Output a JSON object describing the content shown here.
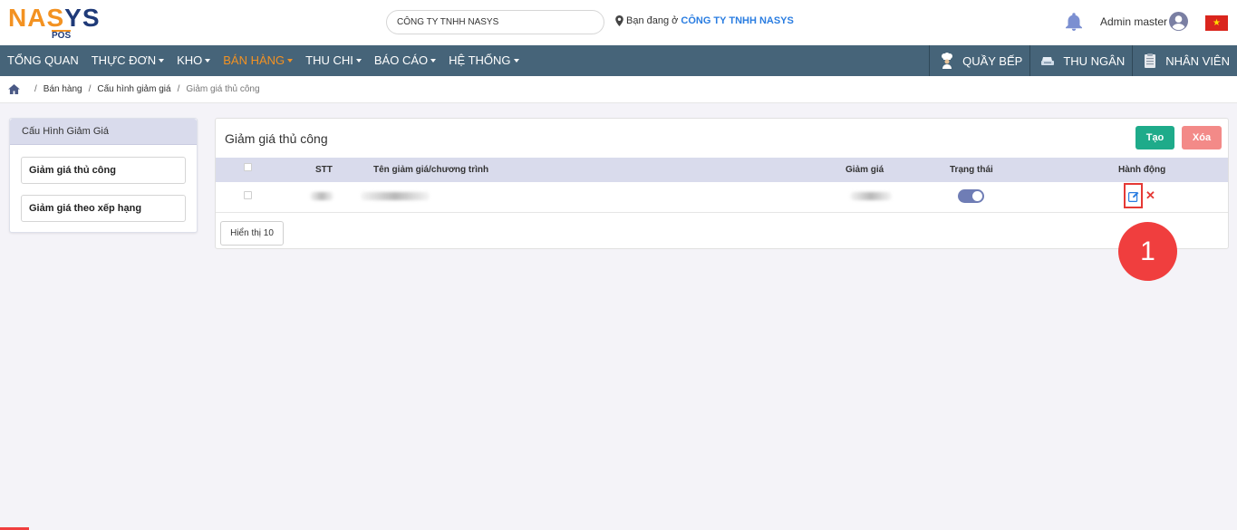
{
  "header": {
    "logo_text_1": "NA",
    "logo_text_2": "S",
    "logo_text_3": "YS",
    "logo_sub": "POS",
    "company_select": "CÔNG TY TNHH NASYS",
    "location_prefix": "Bạn đang ở",
    "location_company": "CÔNG TY TNHH NASYS",
    "user_name": "Admin master",
    "flag_star": "★"
  },
  "nav": {
    "items": [
      {
        "label": "Tổng quan",
        "dropdown": false,
        "active": false
      },
      {
        "label": "Thực đơn",
        "dropdown": true,
        "active": false
      },
      {
        "label": "Kho",
        "dropdown": true,
        "active": false
      },
      {
        "label": "Bán hàng",
        "dropdown": true,
        "active": true
      },
      {
        "label": "Thu chi",
        "dropdown": true,
        "active": false
      },
      {
        "label": "Báo cáo",
        "dropdown": true,
        "active": false
      },
      {
        "label": "Hệ thống",
        "dropdown": true,
        "active": false
      }
    ],
    "right": [
      {
        "label": "Quầy bếp",
        "icon": "chef-icon"
      },
      {
        "label": "Thu ngân",
        "icon": "cashier-icon"
      },
      {
        "label": "Nhân viên",
        "icon": "staff-icon"
      }
    ]
  },
  "breadcrumb": {
    "items": [
      "Bán hàng",
      "Cấu hình giảm giá"
    ],
    "current": "Giảm giá thủ công"
  },
  "sidebar": {
    "title": "Cấu Hình Giảm Giá",
    "links": [
      "Giảm giá thủ công",
      "Giảm giá theo xếp hạng"
    ]
  },
  "main": {
    "title": "Giảm giá thủ công",
    "create_label": "Tạo",
    "delete_label": "Xóa",
    "columns": {
      "stt": "STT",
      "name": "Tên giảm giá/chương trình",
      "discount": "Giảm giá",
      "status": "Trạng thái",
      "action": "Hành động"
    },
    "rows": [
      {
        "status_on": true
      }
    ],
    "page_size_label": "Hiển thị 10",
    "delete_icon_glyph": "✕"
  },
  "annotation": {
    "step": "1"
  },
  "colors": {
    "nav_bg": "#466479",
    "accent": "#f39222",
    "create": "#1eab8a",
    "delete": "#f38a88",
    "highlight": "#e53935",
    "toggle": "#6f7db5"
  }
}
